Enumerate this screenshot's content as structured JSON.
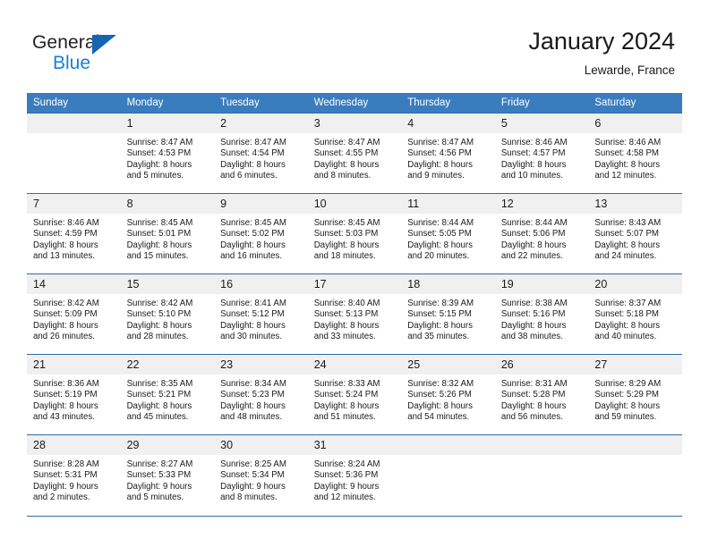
{
  "brand": {
    "name_part1": "General",
    "name_part2": "Blue",
    "triangle_color": "#1565b5",
    "blue_color": "#1a7fd4"
  },
  "header": {
    "title": "January 2024",
    "subtitle": "Lewarde, France"
  },
  "colors": {
    "header_row_bg": "#3a7dbf",
    "daynum_bg": "#f0f0f0",
    "grid_line": "#2e6da4",
    "text": "#1a1a1a"
  },
  "weekdays": [
    "Sunday",
    "Monday",
    "Tuesday",
    "Wednesday",
    "Thursday",
    "Friday",
    "Saturday"
  ],
  "weeks": [
    [
      {
        "day": "",
        "sunrise": "",
        "sunset": "",
        "daylight1": "",
        "daylight2": "",
        "empty": true
      },
      {
        "day": "1",
        "sunrise": "Sunrise: 8:47 AM",
        "sunset": "Sunset: 4:53 PM",
        "daylight1": "Daylight: 8 hours",
        "daylight2": "and 5 minutes."
      },
      {
        "day": "2",
        "sunrise": "Sunrise: 8:47 AM",
        "sunset": "Sunset: 4:54 PM",
        "daylight1": "Daylight: 8 hours",
        "daylight2": "and 6 minutes."
      },
      {
        "day": "3",
        "sunrise": "Sunrise: 8:47 AM",
        "sunset": "Sunset: 4:55 PM",
        "daylight1": "Daylight: 8 hours",
        "daylight2": "and 8 minutes."
      },
      {
        "day": "4",
        "sunrise": "Sunrise: 8:47 AM",
        "sunset": "Sunset: 4:56 PM",
        "daylight1": "Daylight: 8 hours",
        "daylight2": "and 9 minutes."
      },
      {
        "day": "5",
        "sunrise": "Sunrise: 8:46 AM",
        "sunset": "Sunset: 4:57 PM",
        "daylight1": "Daylight: 8 hours",
        "daylight2": "and 10 minutes."
      },
      {
        "day": "6",
        "sunrise": "Sunrise: 8:46 AM",
        "sunset": "Sunset: 4:58 PM",
        "daylight1": "Daylight: 8 hours",
        "daylight2": "and 12 minutes."
      }
    ],
    [
      {
        "day": "7",
        "sunrise": "Sunrise: 8:46 AM",
        "sunset": "Sunset: 4:59 PM",
        "daylight1": "Daylight: 8 hours",
        "daylight2": "and 13 minutes."
      },
      {
        "day": "8",
        "sunrise": "Sunrise: 8:45 AM",
        "sunset": "Sunset: 5:01 PM",
        "daylight1": "Daylight: 8 hours",
        "daylight2": "and 15 minutes."
      },
      {
        "day": "9",
        "sunrise": "Sunrise: 8:45 AM",
        "sunset": "Sunset: 5:02 PM",
        "daylight1": "Daylight: 8 hours",
        "daylight2": "and 16 minutes."
      },
      {
        "day": "10",
        "sunrise": "Sunrise: 8:45 AM",
        "sunset": "Sunset: 5:03 PM",
        "daylight1": "Daylight: 8 hours",
        "daylight2": "and 18 minutes."
      },
      {
        "day": "11",
        "sunrise": "Sunrise: 8:44 AM",
        "sunset": "Sunset: 5:05 PM",
        "daylight1": "Daylight: 8 hours",
        "daylight2": "and 20 minutes."
      },
      {
        "day": "12",
        "sunrise": "Sunrise: 8:44 AM",
        "sunset": "Sunset: 5:06 PM",
        "daylight1": "Daylight: 8 hours",
        "daylight2": "and 22 minutes."
      },
      {
        "day": "13",
        "sunrise": "Sunrise: 8:43 AM",
        "sunset": "Sunset: 5:07 PM",
        "daylight1": "Daylight: 8 hours",
        "daylight2": "and 24 minutes."
      }
    ],
    [
      {
        "day": "14",
        "sunrise": "Sunrise: 8:42 AM",
        "sunset": "Sunset: 5:09 PM",
        "daylight1": "Daylight: 8 hours",
        "daylight2": "and 26 minutes."
      },
      {
        "day": "15",
        "sunrise": "Sunrise: 8:42 AM",
        "sunset": "Sunset: 5:10 PM",
        "daylight1": "Daylight: 8 hours",
        "daylight2": "and 28 minutes."
      },
      {
        "day": "16",
        "sunrise": "Sunrise: 8:41 AM",
        "sunset": "Sunset: 5:12 PM",
        "daylight1": "Daylight: 8 hours",
        "daylight2": "and 30 minutes."
      },
      {
        "day": "17",
        "sunrise": "Sunrise: 8:40 AM",
        "sunset": "Sunset: 5:13 PM",
        "daylight1": "Daylight: 8 hours",
        "daylight2": "and 33 minutes."
      },
      {
        "day": "18",
        "sunrise": "Sunrise: 8:39 AM",
        "sunset": "Sunset: 5:15 PM",
        "daylight1": "Daylight: 8 hours",
        "daylight2": "and 35 minutes."
      },
      {
        "day": "19",
        "sunrise": "Sunrise: 8:38 AM",
        "sunset": "Sunset: 5:16 PM",
        "daylight1": "Daylight: 8 hours",
        "daylight2": "and 38 minutes."
      },
      {
        "day": "20",
        "sunrise": "Sunrise: 8:37 AM",
        "sunset": "Sunset: 5:18 PM",
        "daylight1": "Daylight: 8 hours",
        "daylight2": "and 40 minutes."
      }
    ],
    [
      {
        "day": "21",
        "sunrise": "Sunrise: 8:36 AM",
        "sunset": "Sunset: 5:19 PM",
        "daylight1": "Daylight: 8 hours",
        "daylight2": "and 43 minutes."
      },
      {
        "day": "22",
        "sunrise": "Sunrise: 8:35 AM",
        "sunset": "Sunset: 5:21 PM",
        "daylight1": "Daylight: 8 hours",
        "daylight2": "and 45 minutes."
      },
      {
        "day": "23",
        "sunrise": "Sunrise: 8:34 AM",
        "sunset": "Sunset: 5:23 PM",
        "daylight1": "Daylight: 8 hours",
        "daylight2": "and 48 minutes."
      },
      {
        "day": "24",
        "sunrise": "Sunrise: 8:33 AM",
        "sunset": "Sunset: 5:24 PM",
        "daylight1": "Daylight: 8 hours",
        "daylight2": "and 51 minutes."
      },
      {
        "day": "25",
        "sunrise": "Sunrise: 8:32 AM",
        "sunset": "Sunset: 5:26 PM",
        "daylight1": "Daylight: 8 hours",
        "daylight2": "and 54 minutes."
      },
      {
        "day": "26",
        "sunrise": "Sunrise: 8:31 AM",
        "sunset": "Sunset: 5:28 PM",
        "daylight1": "Daylight: 8 hours",
        "daylight2": "and 56 minutes."
      },
      {
        "day": "27",
        "sunrise": "Sunrise: 8:29 AM",
        "sunset": "Sunset: 5:29 PM",
        "daylight1": "Daylight: 8 hours",
        "daylight2": "and 59 minutes."
      }
    ],
    [
      {
        "day": "28",
        "sunrise": "Sunrise: 8:28 AM",
        "sunset": "Sunset: 5:31 PM",
        "daylight1": "Daylight: 9 hours",
        "daylight2": "and 2 minutes."
      },
      {
        "day": "29",
        "sunrise": "Sunrise: 8:27 AM",
        "sunset": "Sunset: 5:33 PM",
        "daylight1": "Daylight: 9 hours",
        "daylight2": "and 5 minutes."
      },
      {
        "day": "30",
        "sunrise": "Sunrise: 8:25 AM",
        "sunset": "Sunset: 5:34 PM",
        "daylight1": "Daylight: 9 hours",
        "daylight2": "and 8 minutes."
      },
      {
        "day": "31",
        "sunrise": "Sunrise: 8:24 AM",
        "sunset": "Sunset: 5:36 PM",
        "daylight1": "Daylight: 9 hours",
        "daylight2": "and 12 minutes."
      },
      {
        "day": "",
        "sunrise": "",
        "sunset": "",
        "daylight1": "",
        "daylight2": "",
        "empty": true
      },
      {
        "day": "",
        "sunrise": "",
        "sunset": "",
        "daylight1": "",
        "daylight2": "",
        "empty": true
      },
      {
        "day": "",
        "sunrise": "",
        "sunset": "",
        "daylight1": "",
        "daylight2": "",
        "empty": true
      }
    ]
  ]
}
